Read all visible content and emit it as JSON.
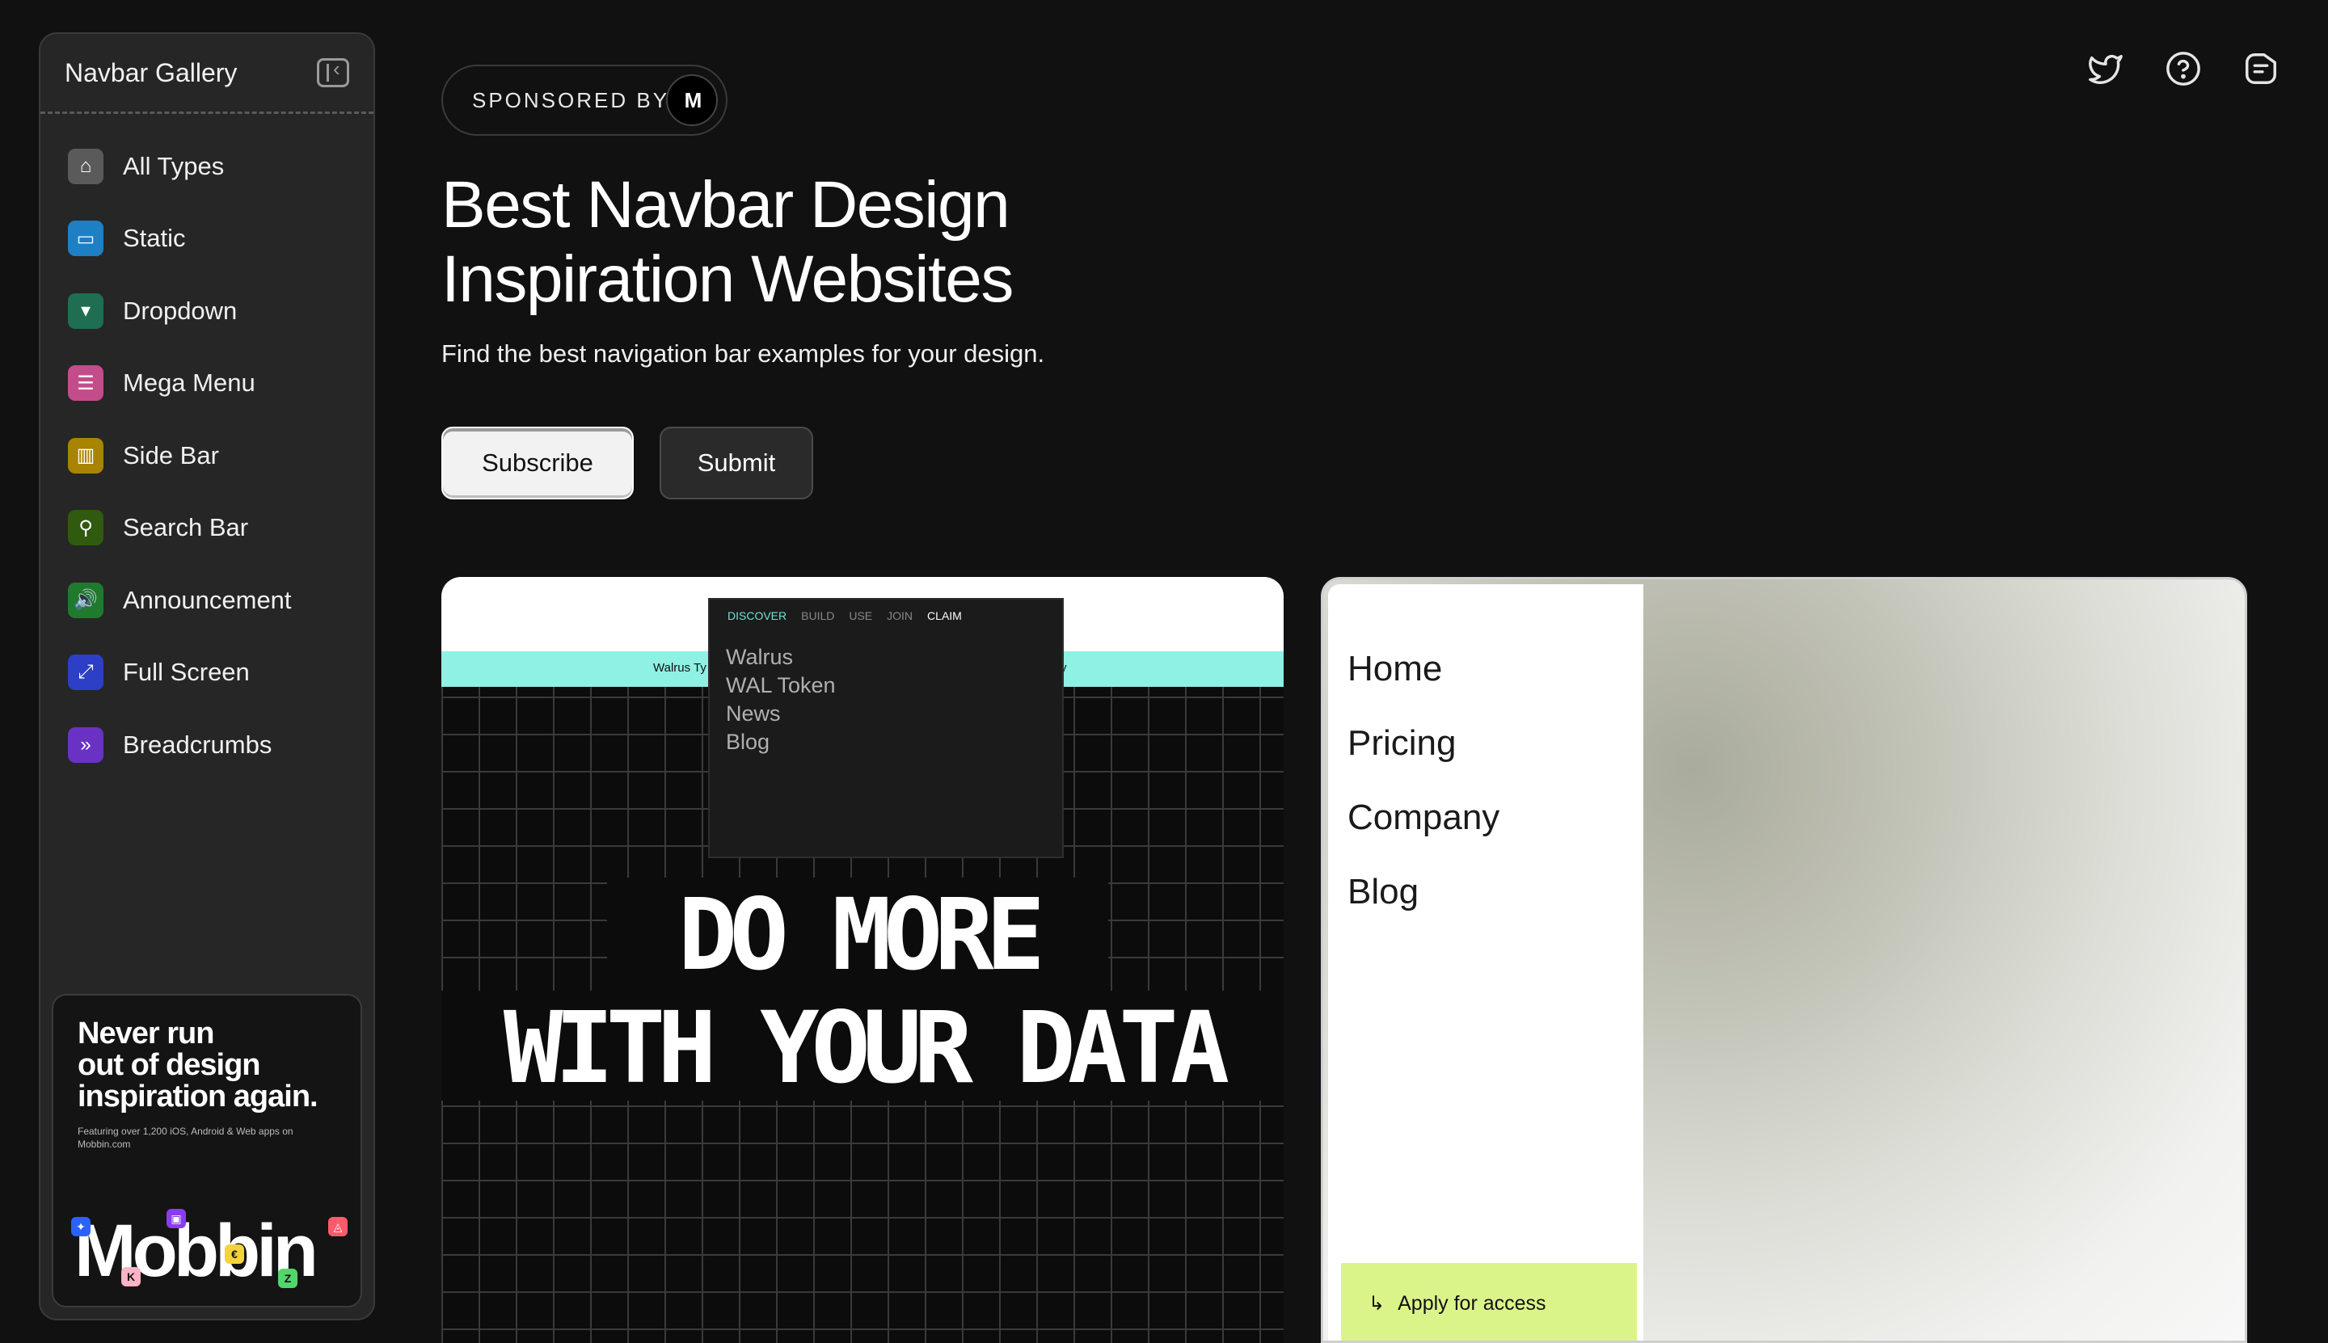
{
  "sidebar": {
    "title": "Navbar Gallery",
    "items": [
      {
        "label": "All Types",
        "icon": "home-icon",
        "color": "#5a5a5a",
        "glyph": "⌂"
      },
      {
        "label": "Static",
        "icon": "browser-window-icon",
        "color": "#1e7fc4",
        "glyph": "▭"
      },
      {
        "label": "Dropdown",
        "icon": "dropdown-window-icon",
        "color": "#1f6e52",
        "glyph": "▾"
      },
      {
        "label": "Mega Menu",
        "icon": "mega-menu-icon",
        "color": "#c24d8a",
        "glyph": "☰"
      },
      {
        "label": "Side Bar",
        "icon": "side-bar-icon",
        "color": "#a88400",
        "glyph": "▥"
      },
      {
        "label": "Search Bar",
        "icon": "search-icon",
        "color": "#2f5a10",
        "glyph": "⚲"
      },
      {
        "label": "Announcement",
        "icon": "speaker-icon",
        "color": "#1f7a2e",
        "glyph": "🔊"
      },
      {
        "label": "Full Screen",
        "icon": "expand-icon",
        "color": "#2c3fc6",
        "glyph": "⤢"
      },
      {
        "label": "Breadcrumbs",
        "icon": "double-chevron-icon",
        "color": "#6a32c4",
        "glyph": "»"
      }
    ],
    "promo": {
      "title": "Never run\nout of design\ninspiration again.",
      "subtitle": "Featuring over 1,200 iOS, Android & Web apps on Mobbin.com",
      "logo": "Mobbin"
    }
  },
  "sponsor": {
    "label": "SPONSORED BY",
    "logo": "M"
  },
  "hero": {
    "title": "Best Navbar Design\nInspiration Websites",
    "subtitle": "Find the best navigation bar examples for your design."
  },
  "buttons": {
    "subscribe": "Subscribe",
    "submit": "Submit"
  },
  "top_icons": [
    "twitter-icon",
    "help-icon",
    "feedback-icon"
  ],
  "card1": {
    "nav": [
      "DISCOVER",
      "BUILD",
      "USE",
      "JOIN",
      "CLAIM"
    ],
    "banner_text": "Walrus Ty",
    "banner_tail": "y",
    "menu_links": [
      "Walrus",
      "WAL Token",
      "News",
      "Blog"
    ],
    "headline_1": "DO MORE",
    "headline_2": "WITH YOUR DATA"
  },
  "card2": {
    "links": [
      "Home",
      "Pricing",
      "Company",
      "Blog"
    ],
    "apply": "Apply for access"
  },
  "colors": {
    "background": "#111111",
    "sidebar": "#262626",
    "cyan_banner": "#8ff0e4",
    "apply_green": "#dbf48a"
  }
}
